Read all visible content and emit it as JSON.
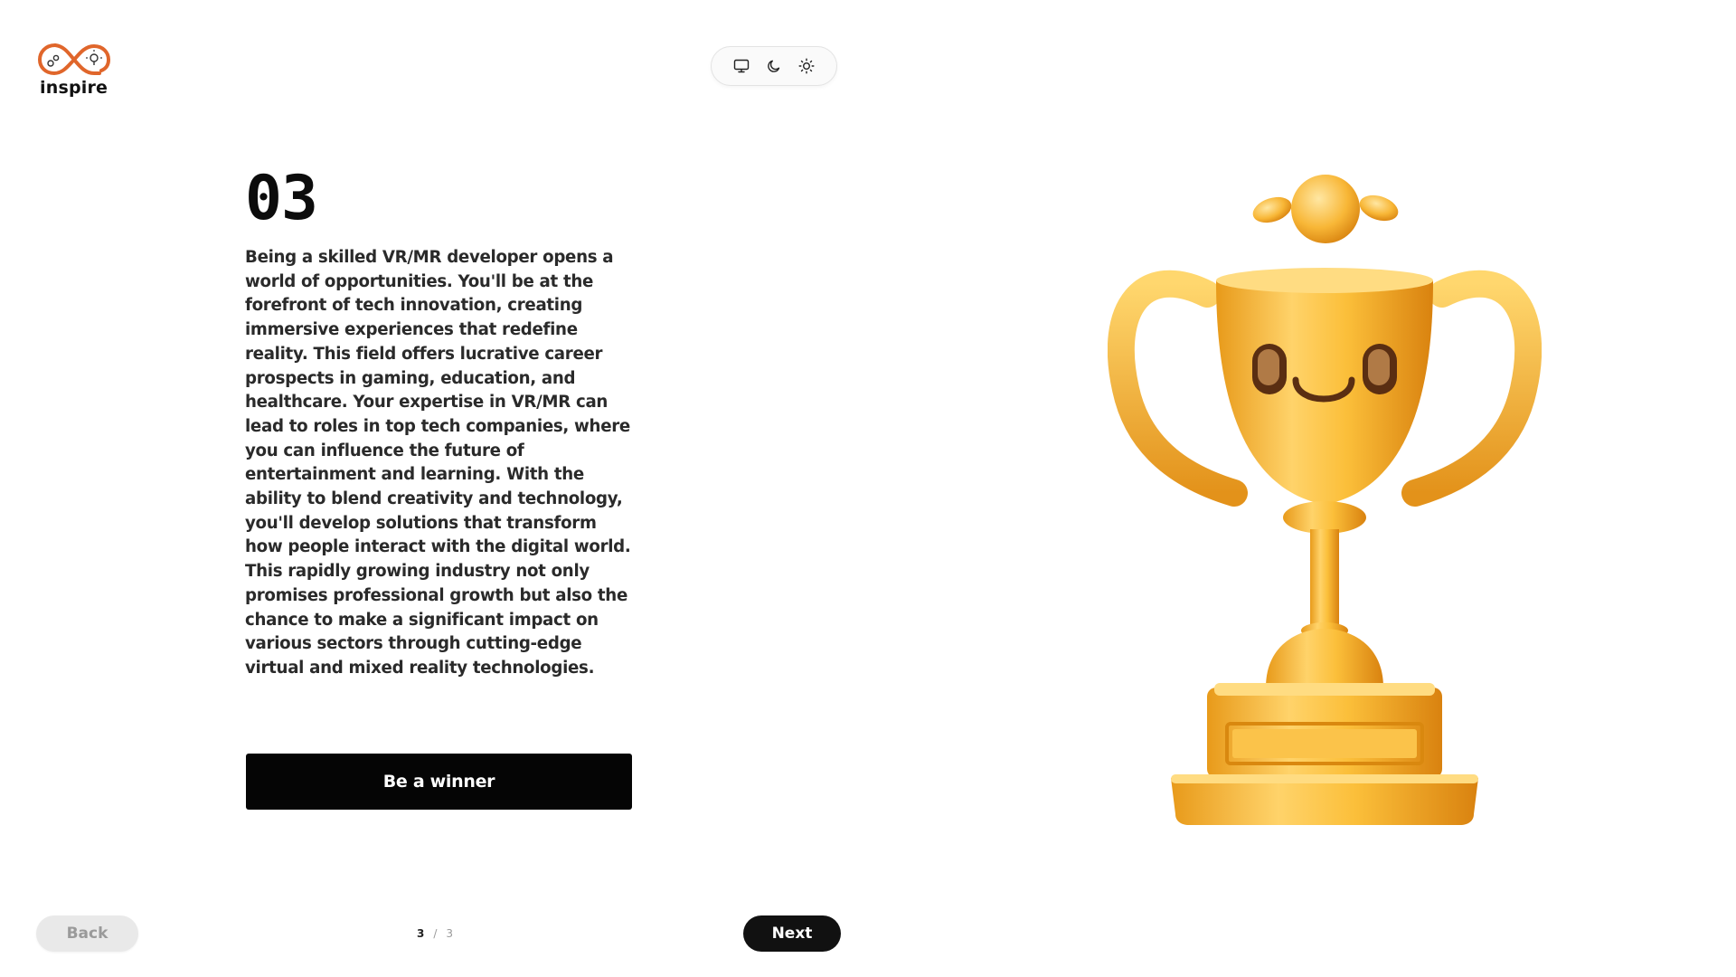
{
  "brand": {
    "name": "inspire",
    "accent_color": "#E0662B"
  },
  "theme_switcher": {
    "options": [
      {
        "icon": "monitor-icon",
        "label": "System"
      },
      {
        "icon": "moon-icon",
        "label": "Dark"
      },
      {
        "icon": "sun-icon",
        "label": "Light"
      }
    ]
  },
  "main": {
    "step_number": "03",
    "description": "Being a skilled VR/MR developer opens a world of opportunities. You'll be at the forefront of tech innovation, creating immersive experiences that redefine reality. This field offers lucrative career prospects in gaming, education, and healthcare. Your expertise in VR/MR can lead to roles in top tech companies, where you can influence the future of entertainment and learning. With the ability to blend creativity and technology, you'll develop solutions that transform how people interact with the digital world. This rapidly growing industry not only promises professional growth but also the chance to make a significant impact on various sectors through cutting-edge virtual and mixed reality technologies.",
    "cta_label": "Be a winner",
    "illustration": "golden-trophy-illustration"
  },
  "footer": {
    "back_label": "Back",
    "next_label": "Next",
    "current_page": "3",
    "separator": "/",
    "total_pages": "3"
  }
}
